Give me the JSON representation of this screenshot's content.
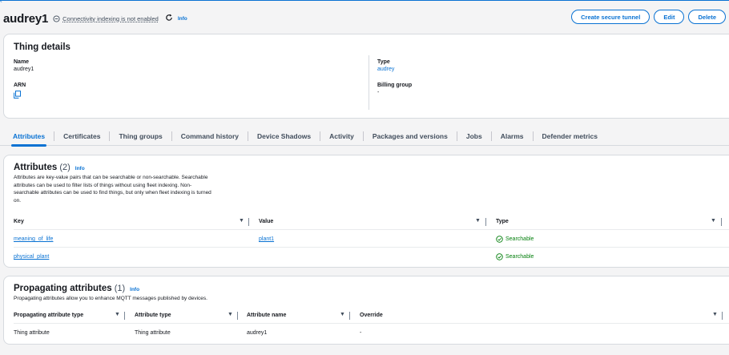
{
  "header": {
    "title": "audrey1",
    "connectivity": "Connectivity indexing is not enabled",
    "info": "Info",
    "buttons": {
      "tunnel": "Create secure tunnel",
      "edit": "Edit",
      "delete": "Delete"
    }
  },
  "details": {
    "heading": "Thing details",
    "name_label": "Name",
    "name_value": "audrey1",
    "arn_label": "ARN",
    "type_label": "Type",
    "type_value": "audrey",
    "billing_label": "Billing group",
    "billing_value": "-"
  },
  "tabs": [
    "Attributes",
    "Certificates",
    "Thing groups",
    "Command history",
    "Device Shadows",
    "Activity",
    "Packages and versions",
    "Jobs",
    "Alarms",
    "Defender metrics"
  ],
  "attributes": {
    "heading": "Attributes",
    "count": "(2)",
    "info": "Info",
    "description": [
      "Attributes are key-value pairs that can be searchable or non-searchable. Searchable",
      "attributes can be used to filter lists of things without using fleet indexing. Non-",
      "searchable attributes can be used to find things, but only when fleet indexing is turned",
      "on."
    ],
    "columns": [
      "Key",
      "Value",
      "Type"
    ],
    "rows": [
      {
        "key": "meaning_of_life",
        "value": "plant1",
        "type": "Searchable"
      },
      {
        "key": "physical_plant",
        "value": "",
        "type": "Searchable"
      }
    ]
  },
  "propagating": {
    "heading": "Propagating attributes",
    "count": "(1)",
    "info": "Info",
    "description": "Propagating attributes allow you to enhance MQTT messages published by devices.",
    "columns": [
      "Propagating attribute type",
      "Attribute type",
      "Attribute name",
      "Override"
    ],
    "rows": [
      {
        "prop_type": "Thing attribute",
        "attr_type": "Thing attribute",
        "attr_name": "audrey1",
        "override": "-"
      }
    ]
  },
  "icons": {
    "status": "info-circle-icon",
    "refresh": "refresh-icon",
    "copy": "copy-icon",
    "check": "check-circle-icon",
    "sort": "caret-down-icon"
  },
  "colors": {
    "accent": "#0972d3",
    "success": "#037f0c",
    "text": "#16191f"
  }
}
